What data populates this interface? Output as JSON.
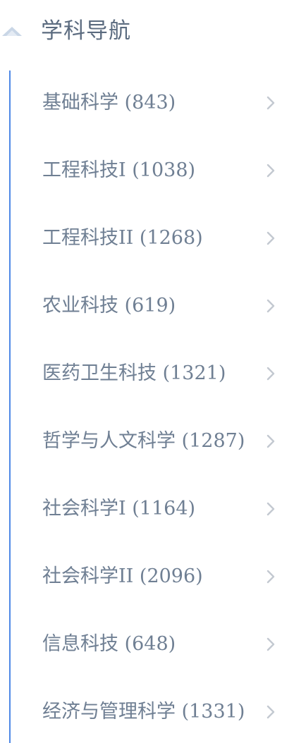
{
  "header": {
    "title": "学科导航",
    "icon": "collapse-up-icon"
  },
  "colors": {
    "title": "#5b6b7f",
    "item_text": "#6f7f93",
    "accent_line": "#4f88e6",
    "chevron": "#c3c9d1"
  },
  "list": {
    "items": [
      {
        "label": "基础科学 (843)"
      },
      {
        "label": "工程科技I (1038)"
      },
      {
        "label": "工程科技II (1268)"
      },
      {
        "label": "农业科技 (619)"
      },
      {
        "label": "医药卫生科技 (1321)"
      },
      {
        "label": "哲学与人文科学 (1287)"
      },
      {
        "label": "社会科学I (1164)"
      },
      {
        "label": "社会科学II (2096)"
      },
      {
        "label": "信息科技 (648)"
      },
      {
        "label": "经济与管理科学 (1331)"
      }
    ]
  }
}
